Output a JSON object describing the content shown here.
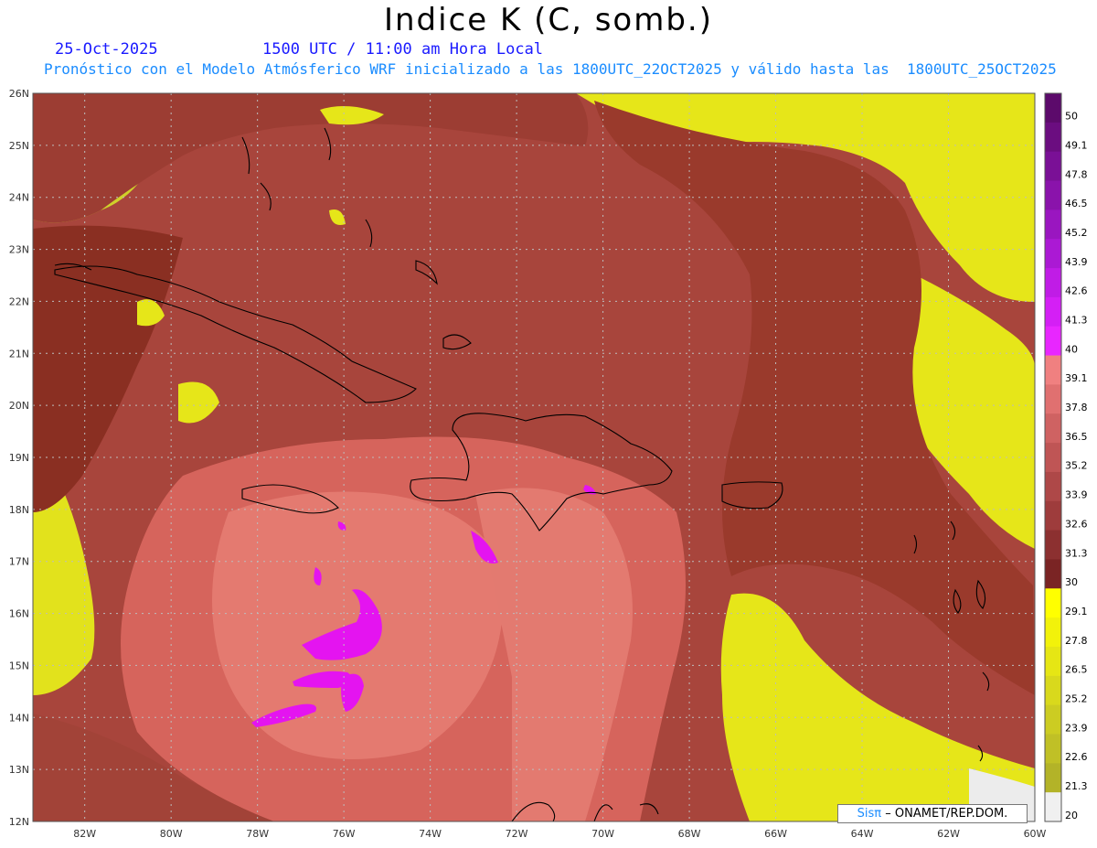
{
  "header": {
    "title": "Indice K (C, somb.)",
    "date": "25-Oct-2025",
    "time": "1500 UTC / 11:00 am Hora Local",
    "forecast": "Pronóstico con el Modelo Atmósferico WRF inicializado a las 1800UTC_22OCT2025 y válido hasta las  1800UTC_25OCT2025"
  },
  "map": {
    "lat_labels": [
      "26N",
      "25N",
      "24N",
      "23N",
      "22N",
      "21N",
      "20N",
      "19N",
      "18N",
      "17N",
      "16N",
      "15N",
      "14N",
      "13N",
      "12N"
    ],
    "lon_labels": [
      "82W",
      "80W",
      "78W",
      "76W",
      "74W",
      "72W",
      "70W",
      "68W",
      "66W",
      "64W",
      "62W",
      "60W"
    ],
    "lat_range": [
      12,
      26
    ],
    "lon_range": [
      -83.2,
      -60
    ],
    "grid": true
  },
  "colorbar": {
    "levels": [
      "50",
      "49.1",
      "47.8",
      "46.5",
      "45.2",
      "43.9",
      "42.6",
      "41.3",
      "40",
      "39.1",
      "37.8",
      "36.5",
      "35.2",
      "33.9",
      "32.6",
      "31.3",
      "30",
      "29.1",
      "27.8",
      "26.5",
      "25.2",
      "23.9",
      "22.6",
      "21.3",
      "20"
    ],
    "colors": [
      "#5c0a6b",
      "#6b0d80",
      "#7a1096",
      "#8a13ab",
      "#9a16c0",
      "#ab19d4",
      "#c01ce6",
      "#d41ff5",
      "#e826ff",
      "#f08080",
      "#e07070",
      "#cf6262",
      "#bf5555",
      "#ae4848",
      "#9e3c3c",
      "#8c3030",
      "#7a2424",
      "#ffff00",
      "#f2f20a",
      "#e6e614",
      "#d9d91c",
      "#cccc22",
      "#c0c026",
      "#b3b328",
      "#f0f0f0"
    ]
  },
  "credit": {
    "brand": "Sisπ",
    "text": "– ONAMET/REP.DOM."
  }
}
